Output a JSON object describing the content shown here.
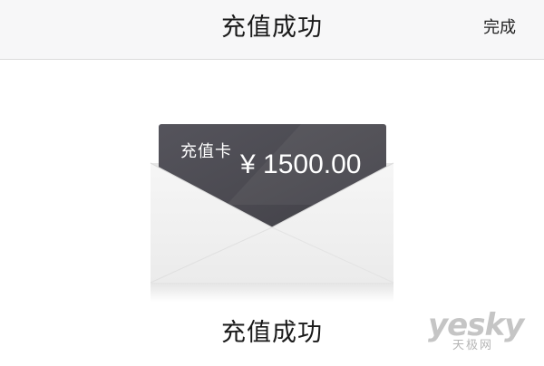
{
  "header": {
    "title": "充值成功",
    "done_label": "完成"
  },
  "card": {
    "label": "充值卡",
    "amount": "¥ 1500.00"
  },
  "result": {
    "title": "充值成功"
  },
  "watermark": {
    "main": "yesky",
    "sub": "天极网"
  },
  "colors": {
    "nav_background": "#f7f7f8",
    "card_background": "#4b4a52",
    "envelope_body": "#f2f2f2",
    "text_primary": "#1a1a1a"
  }
}
